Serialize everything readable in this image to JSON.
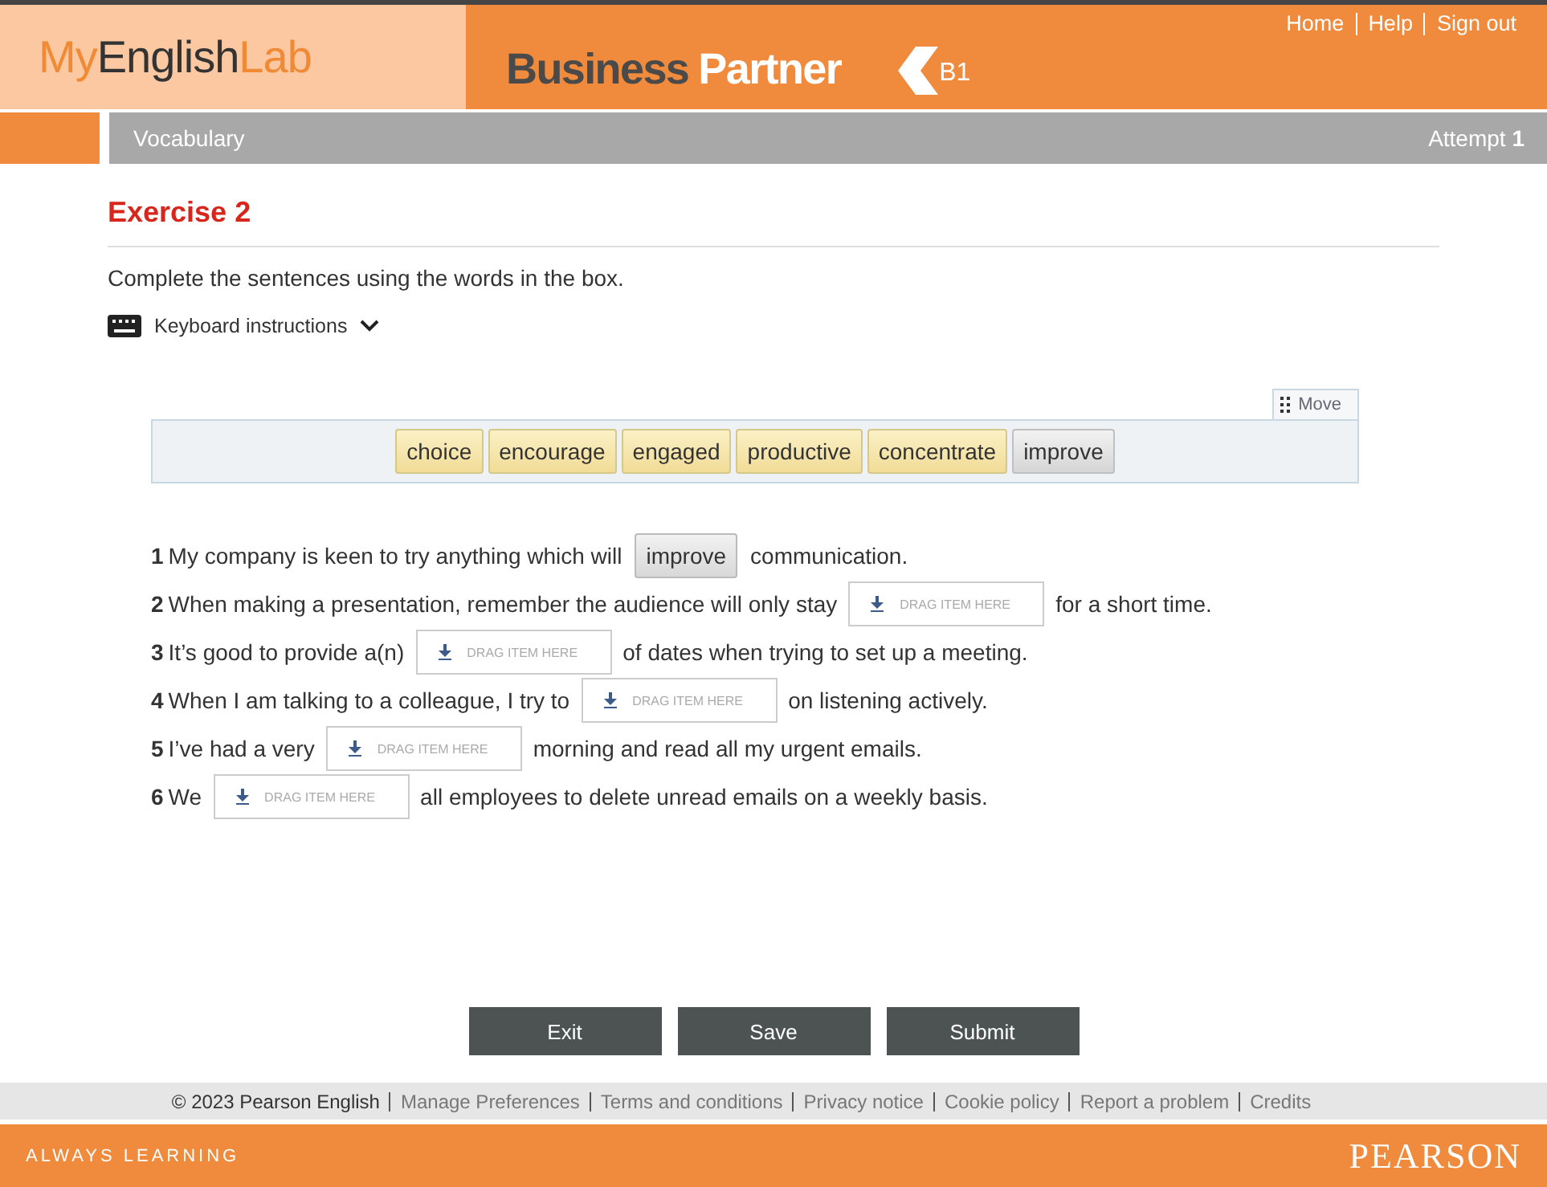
{
  "header": {
    "logo": [
      "My",
      "English",
      "Lab"
    ],
    "course": [
      "Business",
      "Partner"
    ],
    "level": "B1",
    "links": [
      "Home",
      "Help",
      "Sign out"
    ]
  },
  "nav": {
    "section": "Vocabulary",
    "attempt": "Attempt **1**"
  },
  "exercise": {
    "title": "Exercise 2",
    "instruction": "Complete the sentences using the words in the box.",
    "keyboard_instructions": "Keyboard instructions",
    "move": "Move",
    "word_bank": [
      {
        "word": "choice",
        "used": false
      },
      {
        "word": "encourage",
        "used": false
      },
      {
        "word": "engaged",
        "used": false
      },
      {
        "word": "productive",
        "used": false
      },
      {
        "word": "concentrate",
        "used": false
      },
      {
        "word": "improve",
        "used": true
      }
    ],
    "sentences": [
      {
        "number": "1",
        "before": "My company is keen to try anything which will",
        "answer": "improve",
        "after": "communication."
      },
      {
        "number": "2",
        "before": "When making a presentation, remember the audience will only stay",
        "placeholder": "DRAG ITEM HERE",
        "after": "for a short time."
      },
      {
        "number": "3",
        "before": "It’s good to provide a(n)",
        "placeholder": "DRAG ITEM HERE",
        "after": "of dates when trying to set up a meeting."
      },
      {
        "number": "4",
        "before": "When I am talking to a colleague, I try to",
        "placeholder": "DRAG ITEM HERE",
        "after": "on listening actively."
      },
      {
        "number": "5",
        "before": "I’ve had a very",
        "placeholder": "DRAG ITEM HERE",
        "after": "morning and read all my urgent emails."
      },
      {
        "number": "6",
        "before": "We",
        "placeholder": "DRAG ITEM HERE",
        "after": "all employees to delete unread emails on a weekly basis."
      }
    ],
    "buttons": [
      "Exit",
      "Save",
      "Submit"
    ]
  },
  "footer": {
    "copyright": "© 2023 Pearson English",
    "links": [
      "Manage Preferences",
      "Terms and conditions",
      "Privacy notice",
      "Cookie policy",
      "Report a problem",
      "Credits"
    ],
    "tagline": "ALWAYS LEARNING",
    "brand": "PEARSON"
  }
}
